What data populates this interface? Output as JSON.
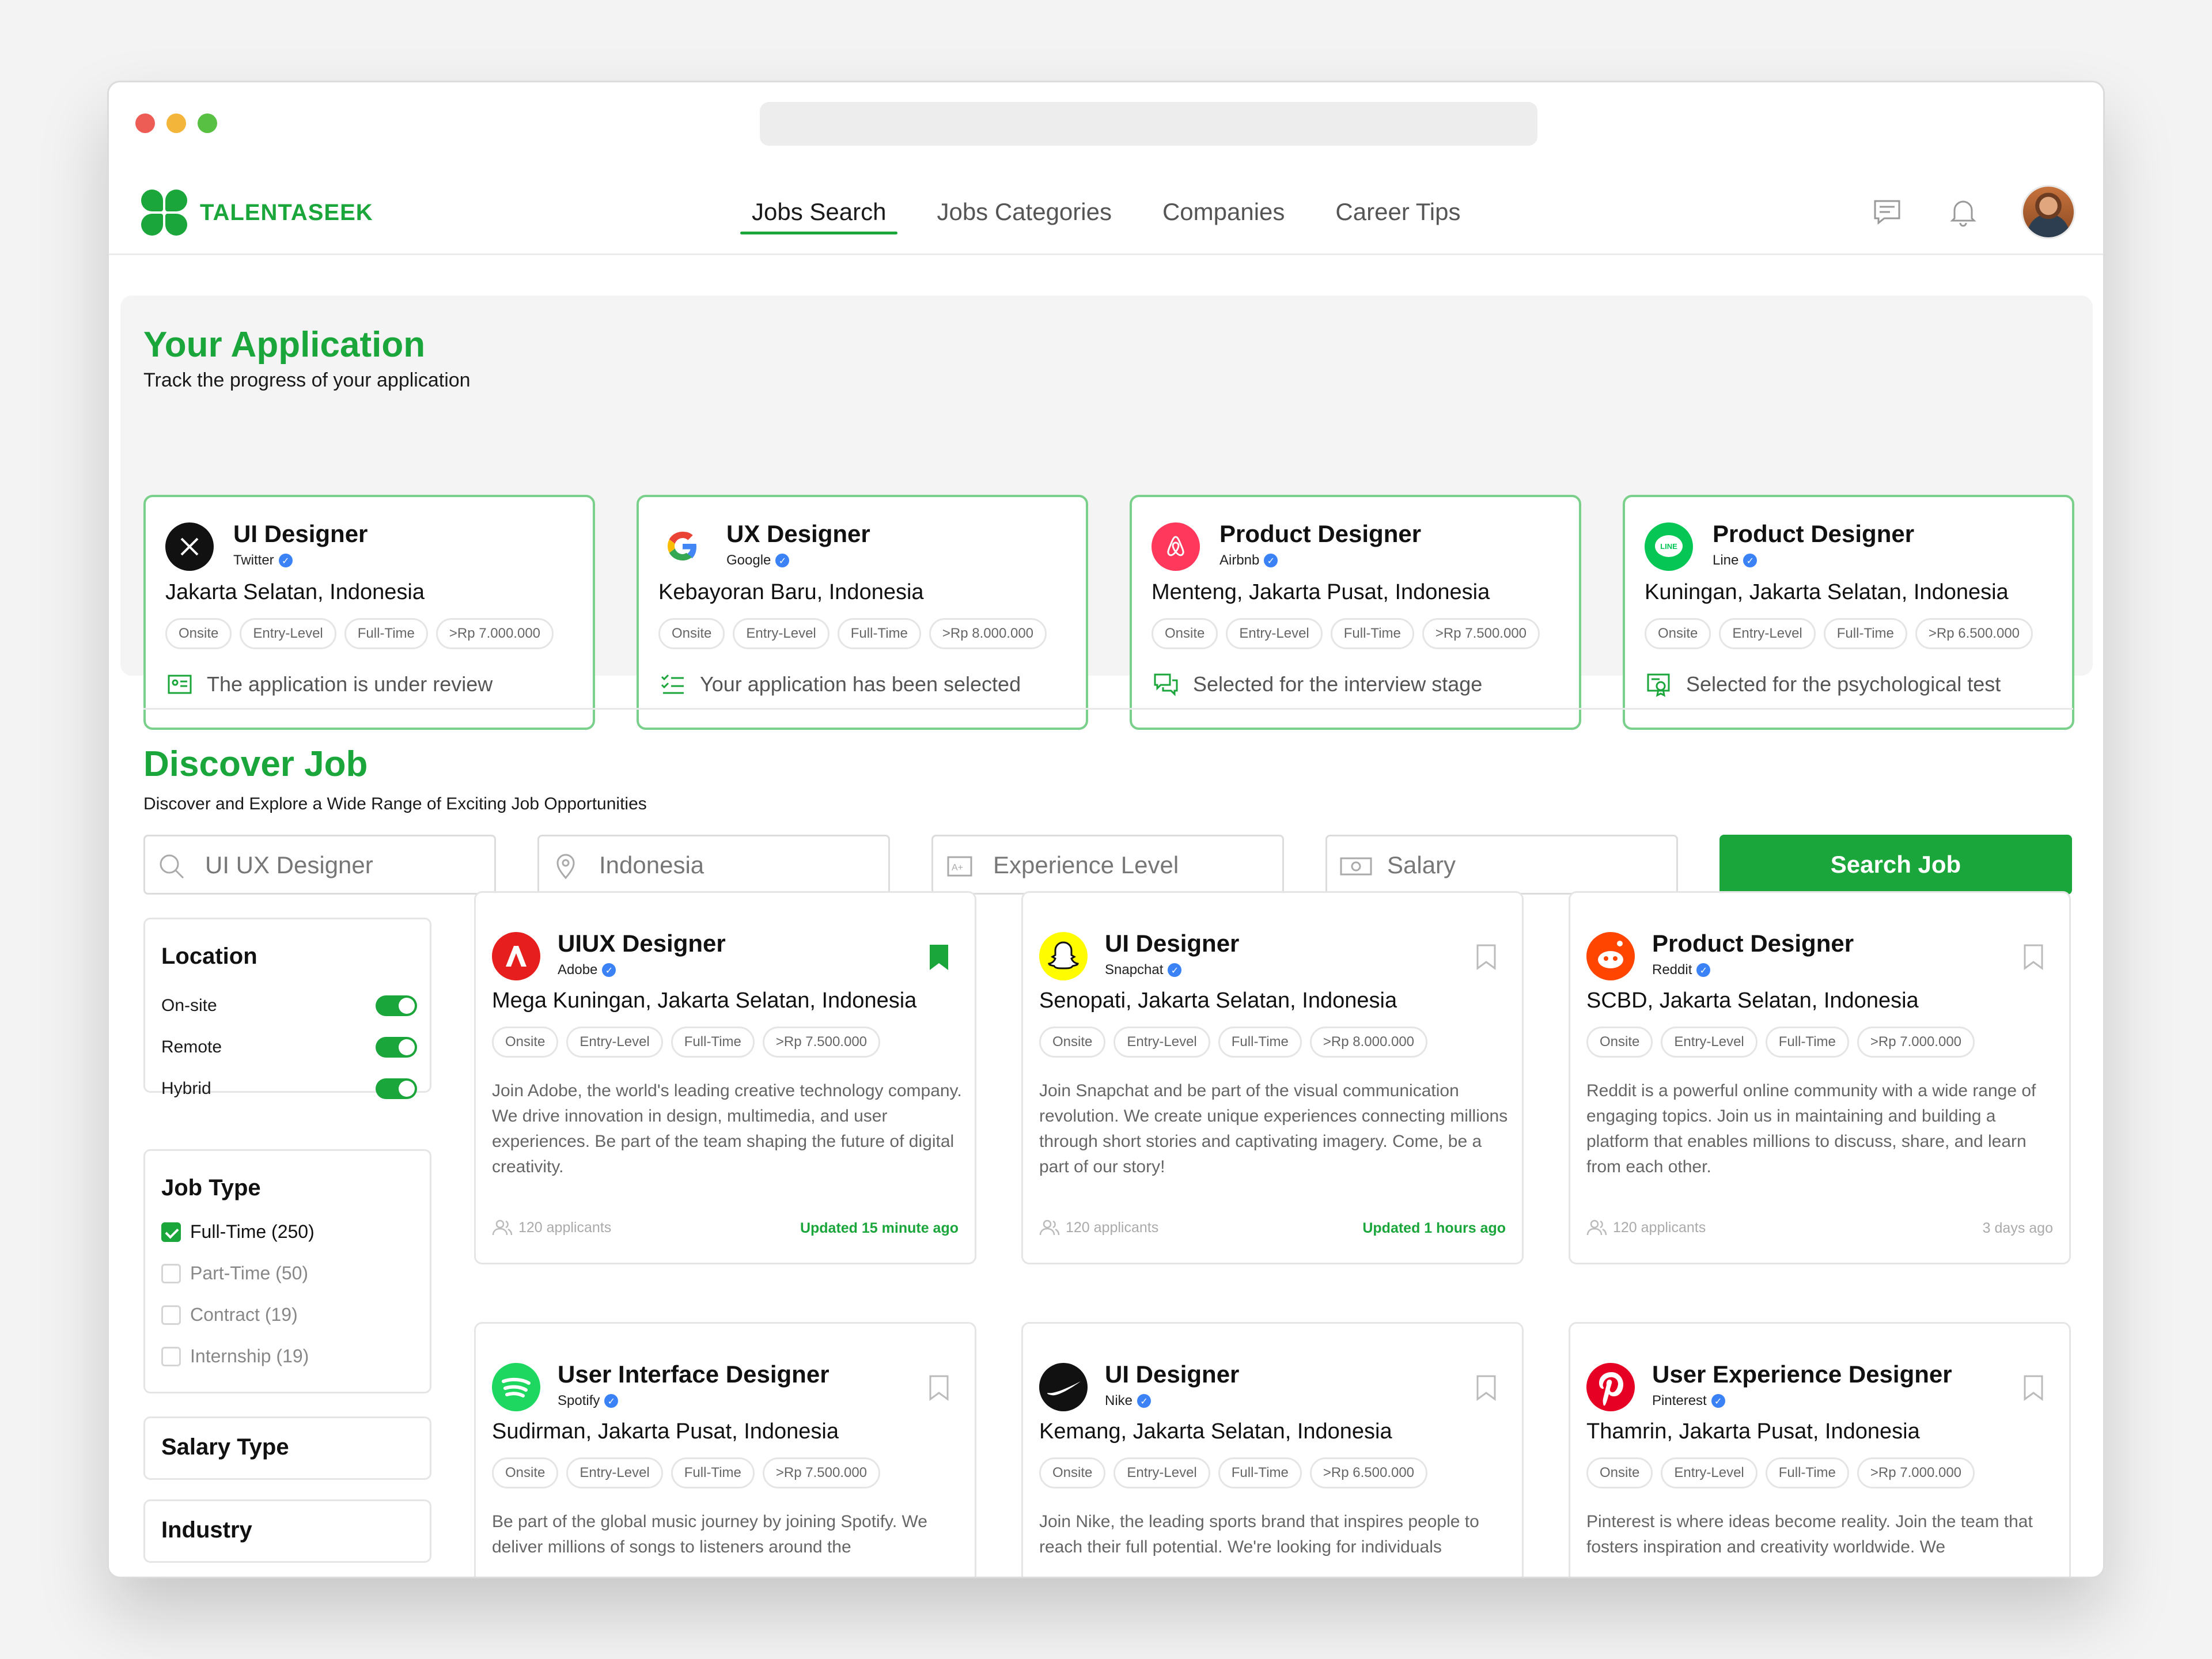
{
  "app": {
    "logo_text": "TALENTASEEK",
    "brand_color": "#1aa63a"
  },
  "nav": {
    "items": [
      "Jobs Search",
      "Jobs Categories",
      "Companies",
      "Career Tips"
    ],
    "active": "Jobs Search"
  },
  "application": {
    "title": "Your Application",
    "subtitle": "Track the progress of your application",
    "cards": [
      {
        "title": "UI Designer",
        "company": "Twitter",
        "location": "Jakarta Selatan, Indonesia",
        "tags": [
          "Onsite",
          "Entry-Level",
          "Full-Time",
          ">Rp 7.000.000"
        ],
        "status": "The application is under review",
        "logo_icon": "x-logo-icon"
      },
      {
        "title": "UX Designer",
        "company": "Google",
        "location": "Kebayoran Baru, Indonesia",
        "tags": [
          "Onsite",
          "Entry-Level",
          "Full-Time",
          ">Rp 8.000.000"
        ],
        "status": "Your application has been selected",
        "logo_icon": "google-logo-icon"
      },
      {
        "title": "Product Designer",
        "company": "Airbnb",
        "location": "Menteng, Jakarta Pusat, Indonesia",
        "tags": [
          "Onsite",
          "Entry-Level",
          "Full-Time",
          ">Rp 7.500.000"
        ],
        "status": "Selected for the interview stage",
        "logo_icon": "airbnb-logo-icon"
      },
      {
        "title": "Product Designer",
        "company": "Line",
        "location": "Kuningan, Jakarta Selatan, Indonesia",
        "tags": [
          "Onsite",
          "Entry-Level",
          "Full-Time",
          ">Rp 6.500.000"
        ],
        "status": "Selected for the psychological test",
        "logo_icon": "line-logo-icon"
      }
    ]
  },
  "discover": {
    "title": "Discover Job",
    "subtitle": "Discover and Explore a Wide Range of Exciting Job Opportunities",
    "search": {
      "keyword": "UI UX Designer",
      "location": "Indonesia",
      "experience": "Experience Level",
      "salary": "Salary",
      "button": "Search Job"
    }
  },
  "filters": {
    "location": {
      "title": "Location",
      "options": [
        "On-site",
        "Remote",
        "Hybrid"
      ]
    },
    "job_type": {
      "title": "Job Type",
      "options": [
        {
          "label": "Full-Time (250)",
          "checked": true
        },
        {
          "label": "Part-Time (50)",
          "checked": false
        },
        {
          "label": "Contract (19)",
          "checked": false
        },
        {
          "label": "Internship (19)",
          "checked": false
        }
      ]
    },
    "salary_type": "Salary Type",
    "industry": "Industry"
  },
  "jobs": [
    {
      "title": "UIUX Designer",
      "company": "Adobe",
      "location": "Mega Kuningan, Jakarta Selatan, Indonesia",
      "tags": [
        "Onsite",
        "Entry-Level",
        "Full-Time",
        ">Rp 7.500.000"
      ],
      "desc": "Join Adobe, the world's leading creative technology company. We drive innovation in design, multimedia, and user experiences. Be part of the team shaping the future of digital creativity.",
      "applicants": "120 applicants",
      "updated": "Updated 15 minute ago",
      "bookmarked": true,
      "logo_color": "#e61e1e"
    },
    {
      "title": "UI Designer",
      "company": "Snapchat",
      "location": "Senopati, Jakarta Selatan, Indonesia",
      "tags": [
        "Onsite",
        "Entry-Level",
        "Full-Time",
        ">Rp 8.000.000"
      ],
      "desc": "Join Snapchat and be part of the visual communication revolution. We create unique experiences connecting millions through short stories and captivating imagery. Come, be a part of our story!",
      "applicants": "120 applicants",
      "updated": "Updated 1 hours ago",
      "bookmarked": false,
      "logo_color": "#fffc00"
    },
    {
      "title": "Product Designer",
      "company": "Reddit",
      "location": "SCBD, Jakarta Selatan, Indonesia",
      "tags": [
        "Onsite",
        "Entry-Level",
        "Full-Time",
        ">Rp 7.000.000"
      ],
      "desc": "Reddit is a powerful online community with a wide range of engaging topics. Join us in maintaining and building a platform that enables millions to discuss, share, and learn from each other.",
      "applicants": "120 applicants",
      "updated": "3 days ago",
      "bookmarked": false,
      "logo_color": "#ff4500"
    },
    {
      "title": "User Interface Designer",
      "company": "Spotify",
      "location": "Sudirman, Jakarta Pusat, Indonesia",
      "tags": [
        "Onsite",
        "Entry-Level",
        "Full-Time",
        ">Rp 7.500.000"
      ],
      "desc": "Be part of the global music journey by joining Spotify. We deliver millions of songs to listeners around the",
      "applicants": "",
      "updated": "",
      "bookmarked": false,
      "logo_color": "#1ed760"
    },
    {
      "title": "UI Designer",
      "company": "Nike",
      "location": "Kemang, Jakarta Selatan, Indonesia",
      "tags": [
        "Onsite",
        "Entry-Level",
        "Full-Time",
        ">Rp 6.500.000"
      ],
      "desc": "Join Nike, the leading sports brand that inspires people to reach their full potential. We're looking for individuals",
      "applicants": "",
      "updated": "",
      "bookmarked": false,
      "logo_color": "#111111"
    },
    {
      "title": "User Experience Designer",
      "company": "Pinterest",
      "location": "Thamrin, Jakarta Pusat, Indonesia",
      "tags": [
        "Onsite",
        "Entry-Level",
        "Full-Time",
        ">Rp 7.000.000"
      ],
      "desc": "Pinterest is where ideas become reality. Join the team that fosters inspiration and creativity worldwide. We",
      "applicants": "",
      "updated": "",
      "bookmarked": false,
      "logo_color": "#e60023"
    }
  ]
}
